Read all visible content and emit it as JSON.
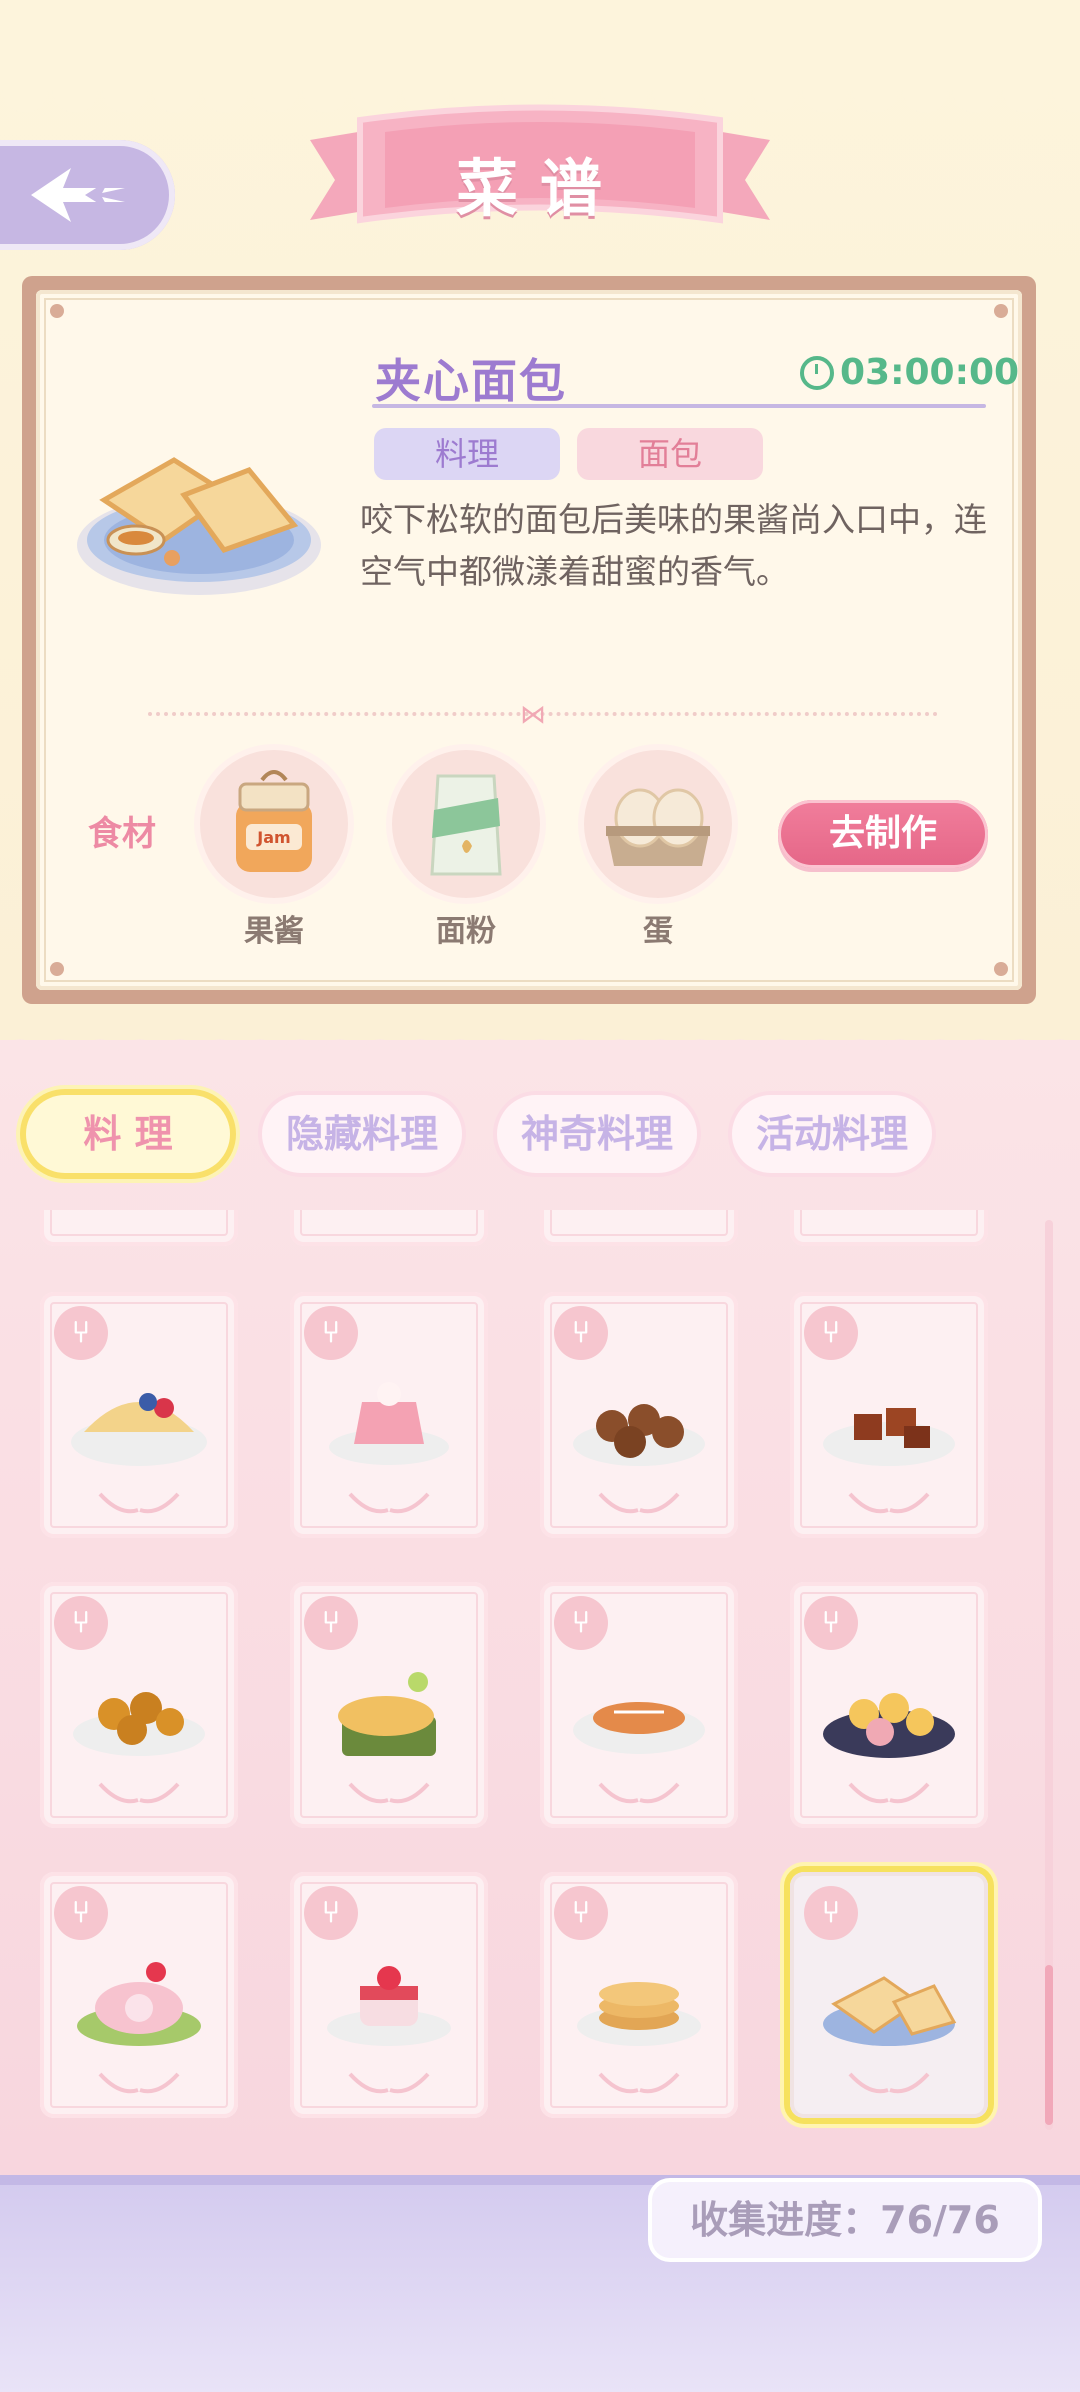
{
  "header": {
    "title": "菜谱"
  },
  "recipe": {
    "name": "夹心面包",
    "time": "03:00:00",
    "tags": [
      "料理",
      "面包"
    ],
    "description": "咬下松软的面包后美味的果酱尚入口中，连空气中都微漾着甜蜜的香气。",
    "ingredients_label": "食材",
    "ingredients": [
      {
        "name": "果酱",
        "icon": "jam-jar-icon"
      },
      {
        "name": "面粉",
        "icon": "flour-bag-icon"
      },
      {
        "name": "蛋",
        "icon": "egg-carton-icon"
      }
    ],
    "make_button": "去制作"
  },
  "tabs": [
    {
      "label": "料 理",
      "active": true
    },
    {
      "label": "隐藏料理",
      "active": false
    },
    {
      "label": "神奇料理",
      "active": false
    },
    {
      "label": "活动料理",
      "active": false
    }
  ],
  "recipe_grid": [
    {
      "dish": "taco-icon"
    },
    {
      "dish": "jelly-icon"
    },
    {
      "dish": "meatballs-icon"
    },
    {
      "dish": "braised-pork-icon"
    },
    {
      "dish": "fried-chicken-icon"
    },
    {
      "dish": "fish-platter-icon"
    },
    {
      "dish": "grilled-fish-icon"
    },
    {
      "dish": "rolls-icon"
    },
    {
      "dish": "swiss-roll-icon"
    },
    {
      "dish": "strawberry-pudding-icon"
    },
    {
      "dish": "pancakes-icon"
    },
    {
      "dish": "sandwich-icon",
      "selected": true
    }
  ],
  "progress": {
    "text": "收集进度：76/76"
  },
  "colors": {
    "accent_pink": "#e56687",
    "accent_purple": "#9d7bd0",
    "timer_green": "#56b88a",
    "highlight_yellow": "#f6e15e"
  }
}
